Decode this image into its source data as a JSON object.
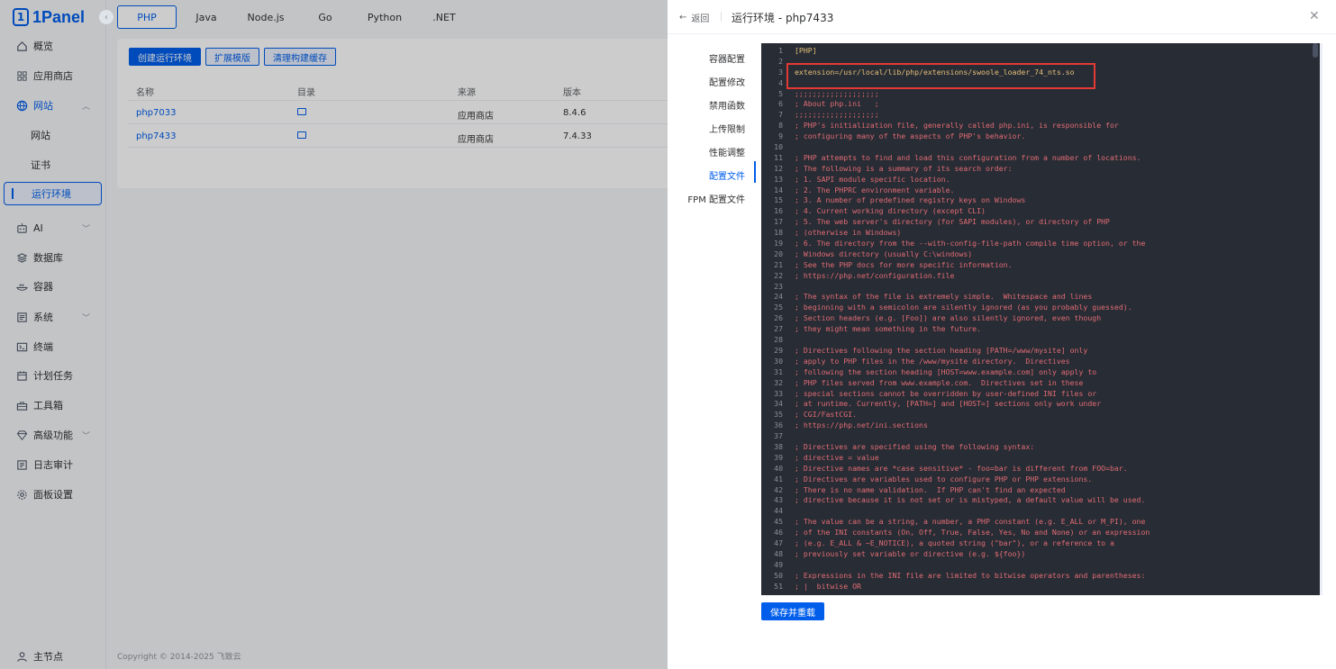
{
  "app": {
    "logo_text": "1Panel"
  },
  "sidebar": {
    "items": [
      {
        "label": "概览",
        "icon": "home-icon"
      },
      {
        "label": "应用商店",
        "icon": "grid-icon"
      },
      {
        "label": "网站",
        "icon": "globe-icon",
        "expanded": true
      },
      {
        "label": "网站",
        "sub": true
      },
      {
        "label": "证书",
        "sub": true
      },
      {
        "label": "运行环境",
        "sub": true,
        "active": true
      },
      {
        "label": "AI",
        "icon": "robot-icon"
      },
      {
        "label": "数据库",
        "icon": "database-icon"
      },
      {
        "label": "容器",
        "icon": "container-icon"
      },
      {
        "label": "系统",
        "icon": "system-icon"
      },
      {
        "label": "终端",
        "icon": "terminal-icon"
      },
      {
        "label": "计划任务",
        "icon": "calendar-icon"
      },
      {
        "label": "工具箱",
        "icon": "toolbox-icon"
      },
      {
        "label": "高级功能",
        "icon": "diamond-icon"
      },
      {
        "label": "日志审计",
        "icon": "log-icon"
      },
      {
        "label": "面板设置",
        "icon": "gear-icon"
      }
    ],
    "node_label": "主节点"
  },
  "tabs": [
    "PHP",
    "Java",
    "Node.js",
    "Go",
    "Python",
    ".NET"
  ],
  "toolbar": {
    "create": "创建运行环境",
    "ext_template": "扩展模版",
    "clear_cache": "清理构建缓存"
  },
  "table": {
    "headers": [
      "名称",
      "目录",
      "来源",
      "版本"
    ],
    "rows": [
      {
        "name": "php7033",
        "source": "应用商店",
        "version": "8.4.6"
      },
      {
        "name": "php7433",
        "source": "应用商店",
        "version": "7.4.33"
      }
    ]
  },
  "copyright": "Copyright © 2014-2025 飞致云",
  "drawer": {
    "back": "返回",
    "title": "运行环境 - php7433",
    "nav": [
      "容器配置",
      "配置修改",
      "禁用函数",
      "上传限制",
      "性能调整",
      "配置文件",
      "FPM 配置文件"
    ],
    "nav_selected": "配置文件",
    "save_button": "保存并重载",
    "code_lines": [
      "[PHP]",
      "",
      "extension=/usr/local/lib/php/extensions/swoole_loader_74_nts.so",
      "",
      ";;;;;;;;;;;;;;;;;;;",
      "; About php.ini   ;",
      ";;;;;;;;;;;;;;;;;;;",
      "; PHP's initialization file, generally called php.ini, is responsible for",
      "; configuring many of the aspects of PHP's behavior.",
      "",
      "; PHP attempts to find and load this configuration from a number of locations.",
      "; The following is a summary of its search order:",
      "; 1. SAPI module specific location.",
      "; 2. The PHPRC environment variable.",
      "; 3. A number of predefined registry keys on Windows",
      "; 4. Current working directory (except CLI)",
      "; 5. The web server's directory (for SAPI modules), or directory of PHP",
      "; (otherwise in Windows)",
      "; 6. The directory from the --with-config-file-path compile time option, or the",
      "; Windows directory (usually C:\\windows)",
      "; See the PHP docs for more specific information.",
      "; https://php.net/configuration.file",
      "",
      "; The syntax of the file is extremely simple.  Whitespace and lines",
      "; beginning with a semicolon are silently ignored (as you probably guessed).",
      "; Section headers (e.g. [Foo]) are also silently ignored, even though",
      "; they might mean something in the future.",
      "",
      "; Directives following the section heading [PATH=/www/mysite] only",
      "; apply to PHP files in the /www/mysite directory.  Directives",
      "; following the section heading [HOST=www.example.com] only apply to",
      "; PHP files served from www.example.com.  Directives set in these",
      "; special sections cannot be overridden by user-defined INI files or",
      "; at runtime. Currently, [PATH=] and [HOST=] sections only work under",
      "; CGI/FastCGI.",
      "; https://php.net/ini.sections",
      "",
      "; Directives are specified using the following syntax:",
      "; directive = value",
      "; Directive names are *case sensitive* - foo=bar is different from FOO=bar.",
      "; Directives are variables used to configure PHP or PHP extensions.",
      "; There is no name validation.  If PHP can't find an expected",
      "; directive because it is not set or is mistyped, a default value will be used.",
      "",
      "; The value can be a string, a number, a PHP constant (e.g. E_ALL or M_PI), one",
      "; of the INI constants (On, Off, True, False, Yes, No and None) or an expression",
      "; (e.g. E_ALL & ~E_NOTICE), a quoted string (\"bar\"), or a reference to a",
      "; previously set variable or directive (e.g. ${foo})",
      "",
      "; Expressions in the INI file are limited to bitwise operators and parentheses:",
      "; |  bitwise OR"
    ]
  },
  "colors": {
    "accent": "#005eeb",
    "editor_bg": "#282c34",
    "highlight_box": "#e53935"
  }
}
